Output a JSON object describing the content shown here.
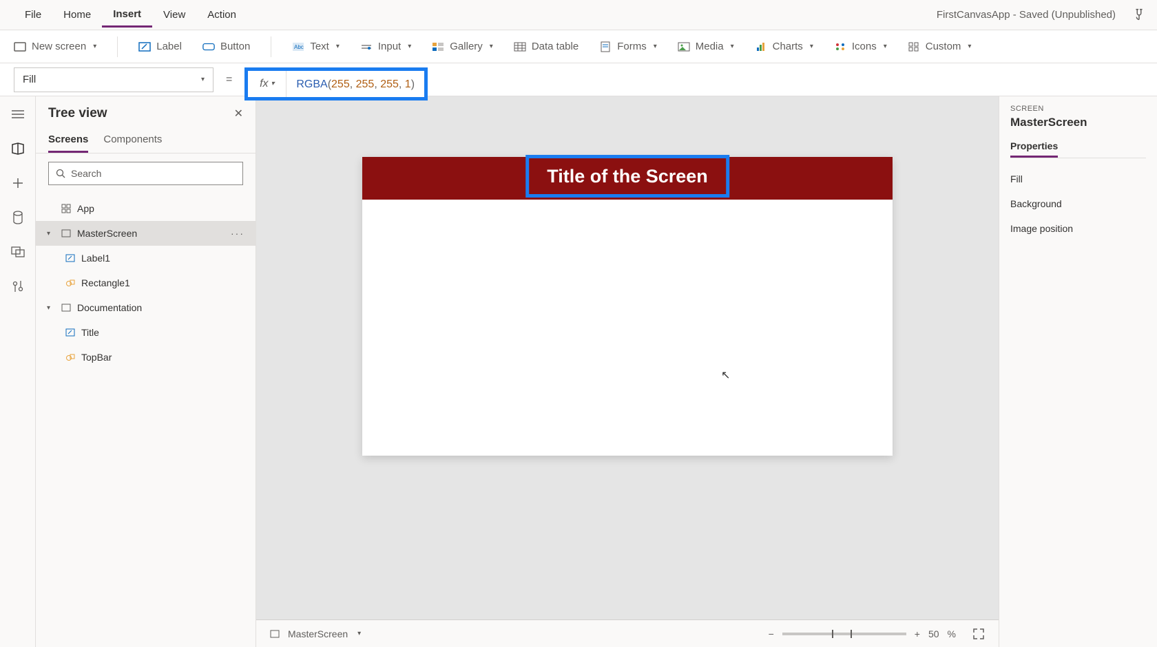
{
  "menu": {
    "items": [
      "File",
      "Home",
      "Insert",
      "View",
      "Action"
    ],
    "active": "Insert",
    "app_title": "FirstCanvasApp - Saved (Unpublished)"
  },
  "ribbon": {
    "new_screen": "New screen",
    "label": "Label",
    "button": "Button",
    "text": "Text",
    "input": "Input",
    "gallery": "Gallery",
    "data_table": "Data table",
    "forms": "Forms",
    "media": "Media",
    "charts": "Charts",
    "icons": "Icons",
    "custom": "Custom"
  },
  "formula": {
    "property": "Fill",
    "fx": "fx",
    "fn": "RGBA",
    "args": [
      "255",
      "255",
      "255",
      "1"
    ]
  },
  "tree": {
    "title": "Tree view",
    "tabs": [
      "Screens",
      "Components"
    ],
    "active_tab": "Screens",
    "search_placeholder": "Search",
    "nodes": {
      "app": "App",
      "master": "MasterScreen",
      "label1": "Label1",
      "rect1": "Rectangle1",
      "doc": "Documentation",
      "title_ctrl": "Title",
      "topbar": "TopBar"
    }
  },
  "canvas": {
    "title_text": "Title of the Screen",
    "topbar_color": "#8b1010"
  },
  "footer": {
    "breadcrumb": "MasterScreen",
    "zoom": "50",
    "zoom_unit": "%"
  },
  "right": {
    "kind": "SCREEN",
    "name": "MasterScreen",
    "tab": "Properties",
    "rows": [
      "Fill",
      "Background",
      "Image position"
    ]
  }
}
